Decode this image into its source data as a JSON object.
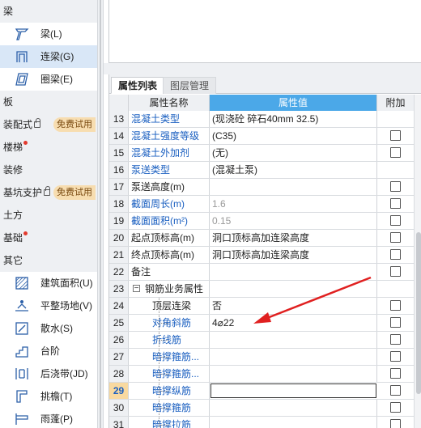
{
  "left_panel": {
    "sec_beam": "梁",
    "items_beam": [
      {
        "label": "梁(L)"
      },
      {
        "label": "连梁(G)"
      },
      {
        "label": "圈梁(E)"
      }
    ],
    "sec_slab": "板",
    "sec_assembly": "装配式",
    "sec_stairs": "楼梯",
    "sec_decoration": "装修",
    "sec_pit": "基坑支护",
    "trial_label": "免费试用",
    "sec_earthwork": "土方",
    "sec_foundation": "基础",
    "sec_other": "其它",
    "items_other": [
      {
        "label": "建筑面积(U)"
      },
      {
        "label": "平整场地(V)"
      },
      {
        "label": "散水(S)"
      },
      {
        "label": "台阶"
      },
      {
        "label": "后浇带(JD)"
      },
      {
        "label": "挑檐(T)"
      },
      {
        "label": "雨蓬(P)"
      }
    ]
  },
  "property_panel": {
    "tab_props": "属性列表",
    "tab_layers": "图层管理",
    "col_name": "属性名称",
    "col_value": "属性值",
    "col_extra": "附加",
    "rows": [
      {
        "num": "13",
        "name": "混凝土类型",
        "value": "(现浇砼 碎石40mm 32.5)"
      },
      {
        "num": "14",
        "name": "混凝土强度等级",
        "value": "(C35)"
      },
      {
        "num": "15",
        "name": "混凝土外加剂",
        "value": "(无)"
      },
      {
        "num": "16",
        "name": "泵送类型",
        "value": "(混凝土泵)"
      },
      {
        "num": "17",
        "name": "泵送高度(m)",
        "value": ""
      },
      {
        "num": "18",
        "name": "截面周长(m)",
        "value": "1.6"
      },
      {
        "num": "19",
        "name": "截面面积(m²)",
        "value": "0.15"
      },
      {
        "num": "20",
        "name": "起点顶标高(m)",
        "value": "洞口顶标高加连梁高度"
      },
      {
        "num": "21",
        "name": "终点顶标高(m)",
        "value": "洞口顶标高加连梁高度"
      },
      {
        "num": "22",
        "name": "备注",
        "value": ""
      },
      {
        "num": "23",
        "name": "钢筋业务属性",
        "value": ""
      },
      {
        "num": "24",
        "name": "顶层连梁",
        "value": "否"
      },
      {
        "num": "25",
        "name": "对角斜筋",
        "value": "4⌀22"
      },
      {
        "num": "26",
        "name": "折线筋",
        "value": ""
      },
      {
        "num": "27",
        "name": "暗撑箍筋...",
        "value": ""
      },
      {
        "num": "28",
        "name": "暗撑箍筋...",
        "value": ""
      },
      {
        "num": "29",
        "name": "暗撑纵筋",
        "value": ""
      },
      {
        "num": "30",
        "name": "暗撑箍筋",
        "value": ""
      },
      {
        "num": "31",
        "name": "暗撑拉筋",
        "value": ""
      }
    ]
  },
  "colors": {
    "header_blue": "#4ba8e8",
    "link_blue": "#1a5fc0",
    "selection": "#d9e7f7",
    "trial_badge": "#f7ddb0",
    "arrow_red": "#e02020"
  }
}
